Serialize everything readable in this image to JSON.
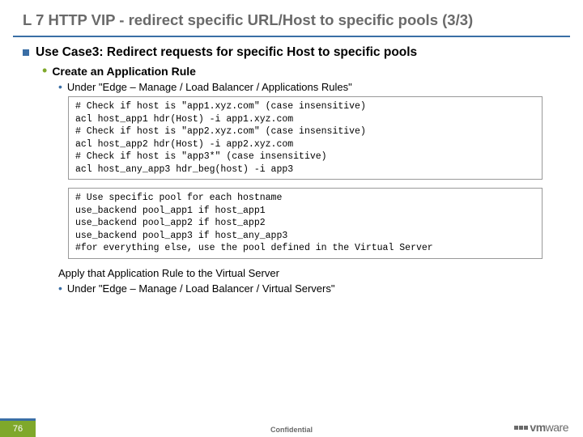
{
  "title": "L 7 HTTP VIP - redirect specific URL/Host to specific pools (3/3)",
  "use_case": "Use Case3: Redirect requests for specific Host to specific pools",
  "create_rule": "Create an Application Rule",
  "under_apprules": "Under \"Edge – Manage /  Load Balancer / Applications Rules\"",
  "code1": [
    "# Check if host is \"app1.xyz.com\" (case insensitive)",
    "acl host_app1 hdr(Host) -i app1.xyz.com",
    "# Check if host is \"app2.xyz.com\" (case insensitive)",
    "acl host_app2 hdr(Host) -i app2.xyz.com",
    "# Check if host is \"app3*\" (case insensitive)",
    "acl host_any_app3 hdr_beg(host) -i app3"
  ],
  "code2": [
    "# Use specific pool for each hostname",
    "use_backend pool_app1 if host_app1",
    "use_backend pool_app2 if host_app2",
    "use_backend pool_app3 if host_any_app3",
    "#for everything else, use the pool defined in the Virtual Server"
  ],
  "apply": "Apply that Application Rule to the Virtual Server",
  "under_vs": "Under \"Edge – Manage /  Load Balancer / Virtual Servers\"",
  "slide_number": "76",
  "confidential": "Confidential",
  "logo_text_bold": "vm",
  "logo_text_rest": "ware"
}
